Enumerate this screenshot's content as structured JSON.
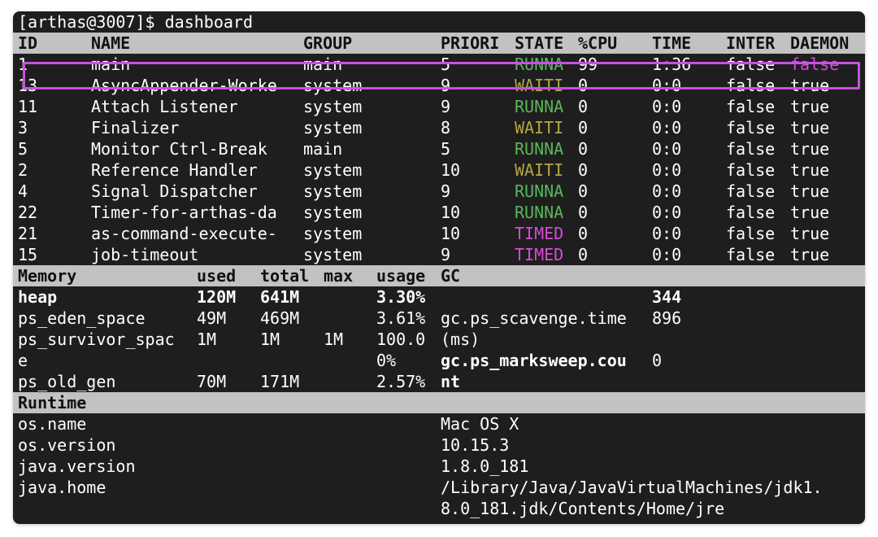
{
  "prompt": "[arthas@3007]$ dashboard",
  "thread_headers": [
    "ID",
    "NAME",
    "GROUP",
    "PRIORI",
    "STATE",
    "%CPU",
    "TIME",
    "INTER",
    "DAEMON"
  ],
  "threads": [
    {
      "id": "1",
      "name": "main",
      "group": "main",
      "priority": "5",
      "state": "RUNNA",
      "cpu": "99",
      "time": "1:36",
      "inter": "false",
      "daemon": "false"
    },
    {
      "id": "13",
      "name": "AsyncAppender-Worke",
      "group": "system",
      "priority": "9",
      "state": "WAITI",
      "cpu": "0",
      "time": "0:0",
      "inter": "false",
      "daemon": "true"
    },
    {
      "id": "11",
      "name": "Attach Listener",
      "group": "system",
      "priority": "9",
      "state": "RUNNA",
      "cpu": "0",
      "time": "0:0",
      "inter": "false",
      "daemon": "true"
    },
    {
      "id": "3",
      "name": "Finalizer",
      "group": "system",
      "priority": "8",
      "state": "WAITI",
      "cpu": "0",
      "time": "0:0",
      "inter": "false",
      "daemon": "true"
    },
    {
      "id": "5",
      "name": "Monitor Ctrl-Break",
      "group": "main",
      "priority": "5",
      "state": "RUNNA",
      "cpu": "0",
      "time": "0:0",
      "inter": "false",
      "daemon": "true"
    },
    {
      "id": "2",
      "name": "Reference Handler",
      "group": "system",
      "priority": "10",
      "state": "WAITI",
      "cpu": "0",
      "time": "0:0",
      "inter": "false",
      "daemon": "true"
    },
    {
      "id": "4",
      "name": "Signal Dispatcher",
      "group": "system",
      "priority": "9",
      "state": "RUNNA",
      "cpu": "0",
      "time": "0:0",
      "inter": "false",
      "daemon": "true"
    },
    {
      "id": "22",
      "name": "Timer-for-arthas-da",
      "group": "system",
      "priority": "10",
      "state": "RUNNA",
      "cpu": "0",
      "time": "0:0",
      "inter": "false",
      "daemon": "true"
    },
    {
      "id": "21",
      "name": "as-command-execute-",
      "group": "system",
      "priority": "10",
      "state": "TIMED",
      "cpu": "0",
      "time": "0:0",
      "inter": "false",
      "daemon": "true"
    },
    {
      "id": "15",
      "name": "job-timeout",
      "group": "system",
      "priority": "9",
      "state": "TIMED",
      "cpu": "0",
      "time": "0:0",
      "inter": "false",
      "daemon": "true"
    }
  ],
  "memory_headers": [
    "Memory",
    "used",
    "total",
    "max",
    "usage",
    "GC"
  ],
  "memory_lines": [
    {
      "c0": "heap",
      "c1": "120M",
      "c2": "641M",
      "c3": "",
      "c4": "3.30%",
      "c5": "",
      "c6": "344",
      "bold": true
    },
    {
      "c0": "ps_eden_space",
      "c1": "49M",
      "c2": "469M",
      "c3": "",
      "c4": "3.61%",
      "c5": "gc.ps_scavenge.time",
      "c6": "896",
      "bold": false
    },
    {
      "c0": "ps_survivor_spac",
      "c1": "1M",
      "c2": "1M",
      "c3": "1M",
      "c4": "100.0",
      "c5": "(ms)",
      "c6": "",
      "bold": false
    },
    {
      "c0": "e",
      "c1": "",
      "c2": "",
      "c3": "",
      "c4": "0%",
      "c5": "gc.ps_marksweep.cou",
      "c6": "0",
      "bold": false,
      "bold5": true
    },
    {
      "c0": "ps_old_gen",
      "c1": "70M",
      "c2": "171M",
      "c3": "",
      "c4": "2.57%",
      "c5": "nt",
      "c6": "",
      "bold": false,
      "bold5": true
    }
  ],
  "runtime_header": "Runtime",
  "runtime_lines": [
    {
      "key": "os.name",
      "value": "Mac OS X"
    },
    {
      "key": "os.version",
      "value": "10.15.3"
    },
    {
      "key": "java.version",
      "value": "1.8.0_181"
    },
    {
      "key": "java.home",
      "value": "/Library/Java/JavaVirtualMachines/jdk1."
    },
    {
      "key": "",
      "value": "8.0_181.jdk/Contents/Home/jre"
    }
  ],
  "colors": {
    "terminal_bg": "#1e1e1e",
    "header_band": "#c2c2c2",
    "running": "#5ab65a",
    "waiting": "#b5a642",
    "timed": "#d84ad8",
    "highlight": "#c552e0"
  }
}
